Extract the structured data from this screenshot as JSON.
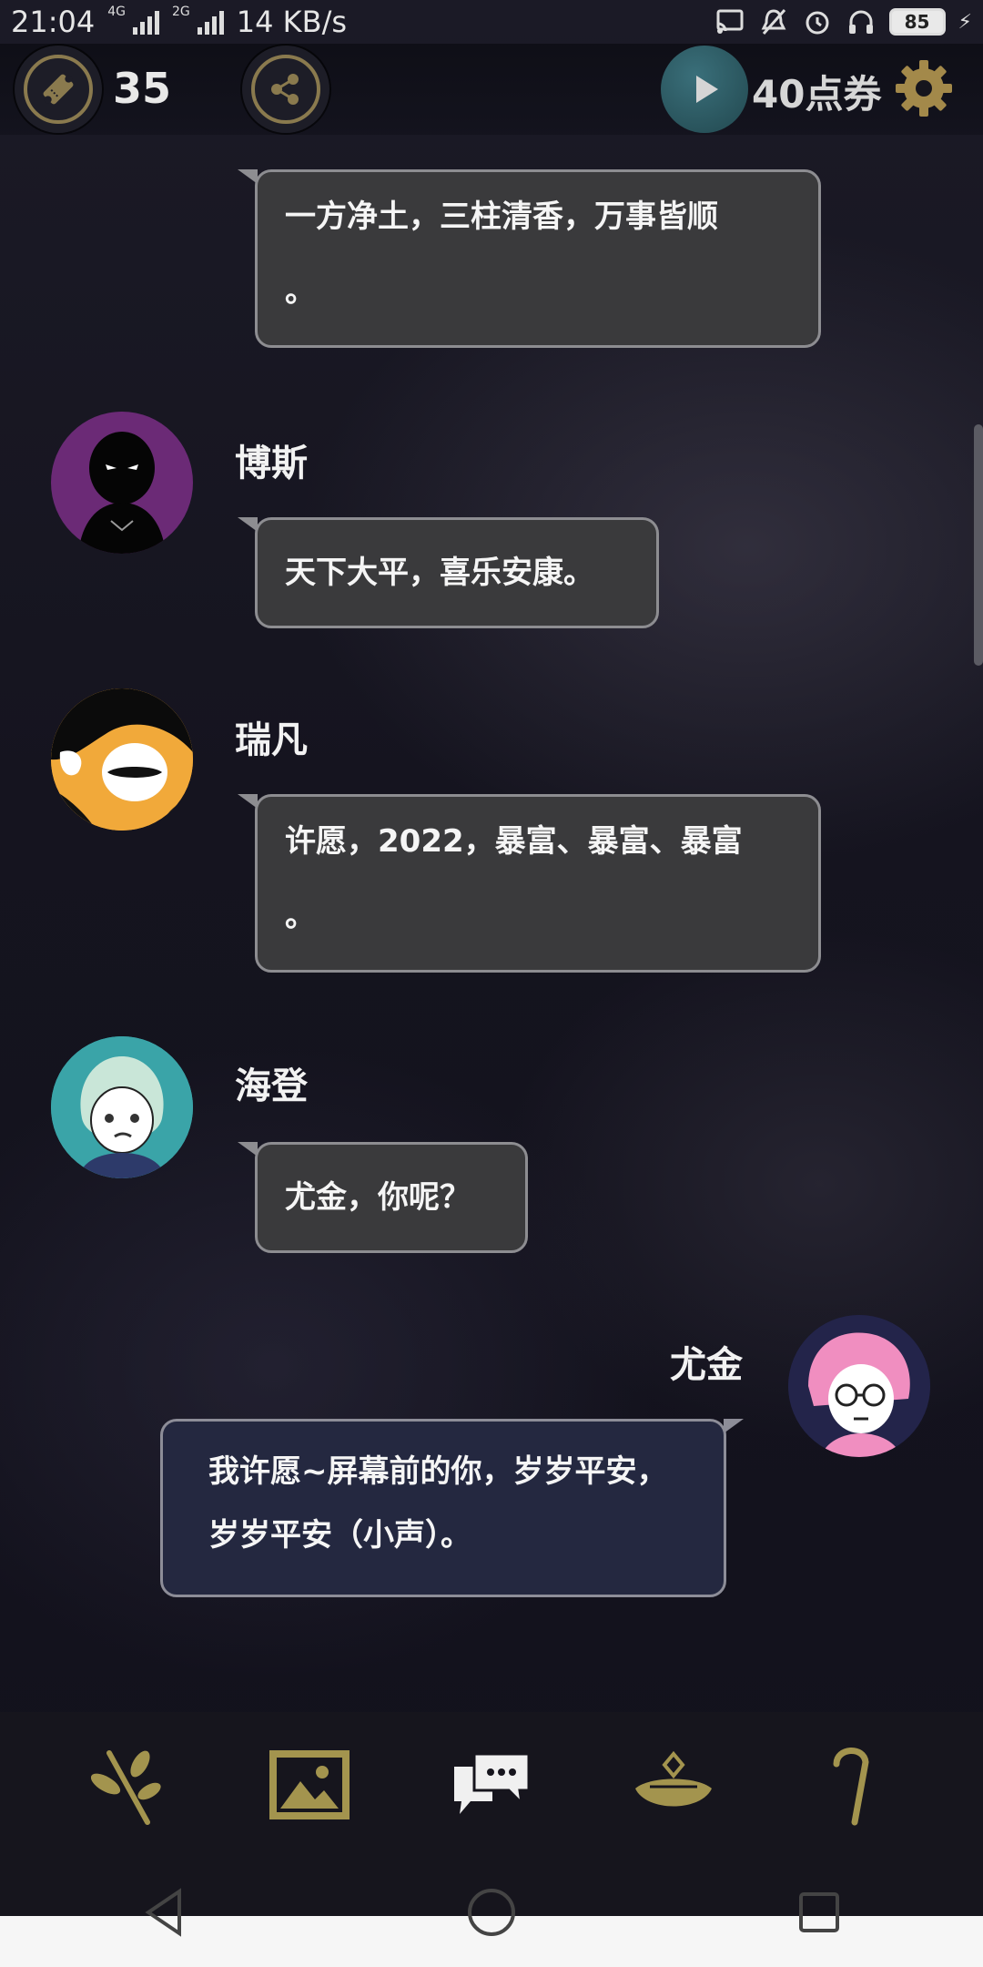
{
  "status_bar": {
    "time": "21:04",
    "network_1": "4G",
    "network_2": "2G",
    "speed": "14 KB/s",
    "battery": "85"
  },
  "top_bar": {
    "ticket_count": "35",
    "points_label": "40点券"
  },
  "chat": [
    {
      "id": "m1",
      "sender": "",
      "text_line1": "一方净土，三柱清香，万事皆顺",
      "text_line2": "。"
    },
    {
      "id": "m2",
      "sender": "博斯",
      "text_line1": "天下大平，喜乐安康。"
    },
    {
      "id": "m3",
      "sender": "瑞凡",
      "text_line1": "许愿，2022，暴富、暴富、暴富",
      "text_line2": "。"
    },
    {
      "id": "m4",
      "sender": "海登",
      "text_line1": "尤金，你呢？"
    },
    {
      "id": "m5",
      "sender": "尤金",
      "text_line1": "我许愿~屏幕前的你，岁岁平安，",
      "text_line2": "岁岁平安（小声）。"
    }
  ],
  "colors": {
    "accent_gold": "#8a7a4e",
    "toolbar_icon_gold": "#a3944e",
    "bubble_other": "#3a3a3c",
    "bubble_me": "#242840"
  },
  "toolbar_icons": [
    "branch-icon",
    "picture-icon",
    "chat-icon",
    "hat-icon",
    "cane-icon"
  ],
  "active_tool": "chat-icon"
}
